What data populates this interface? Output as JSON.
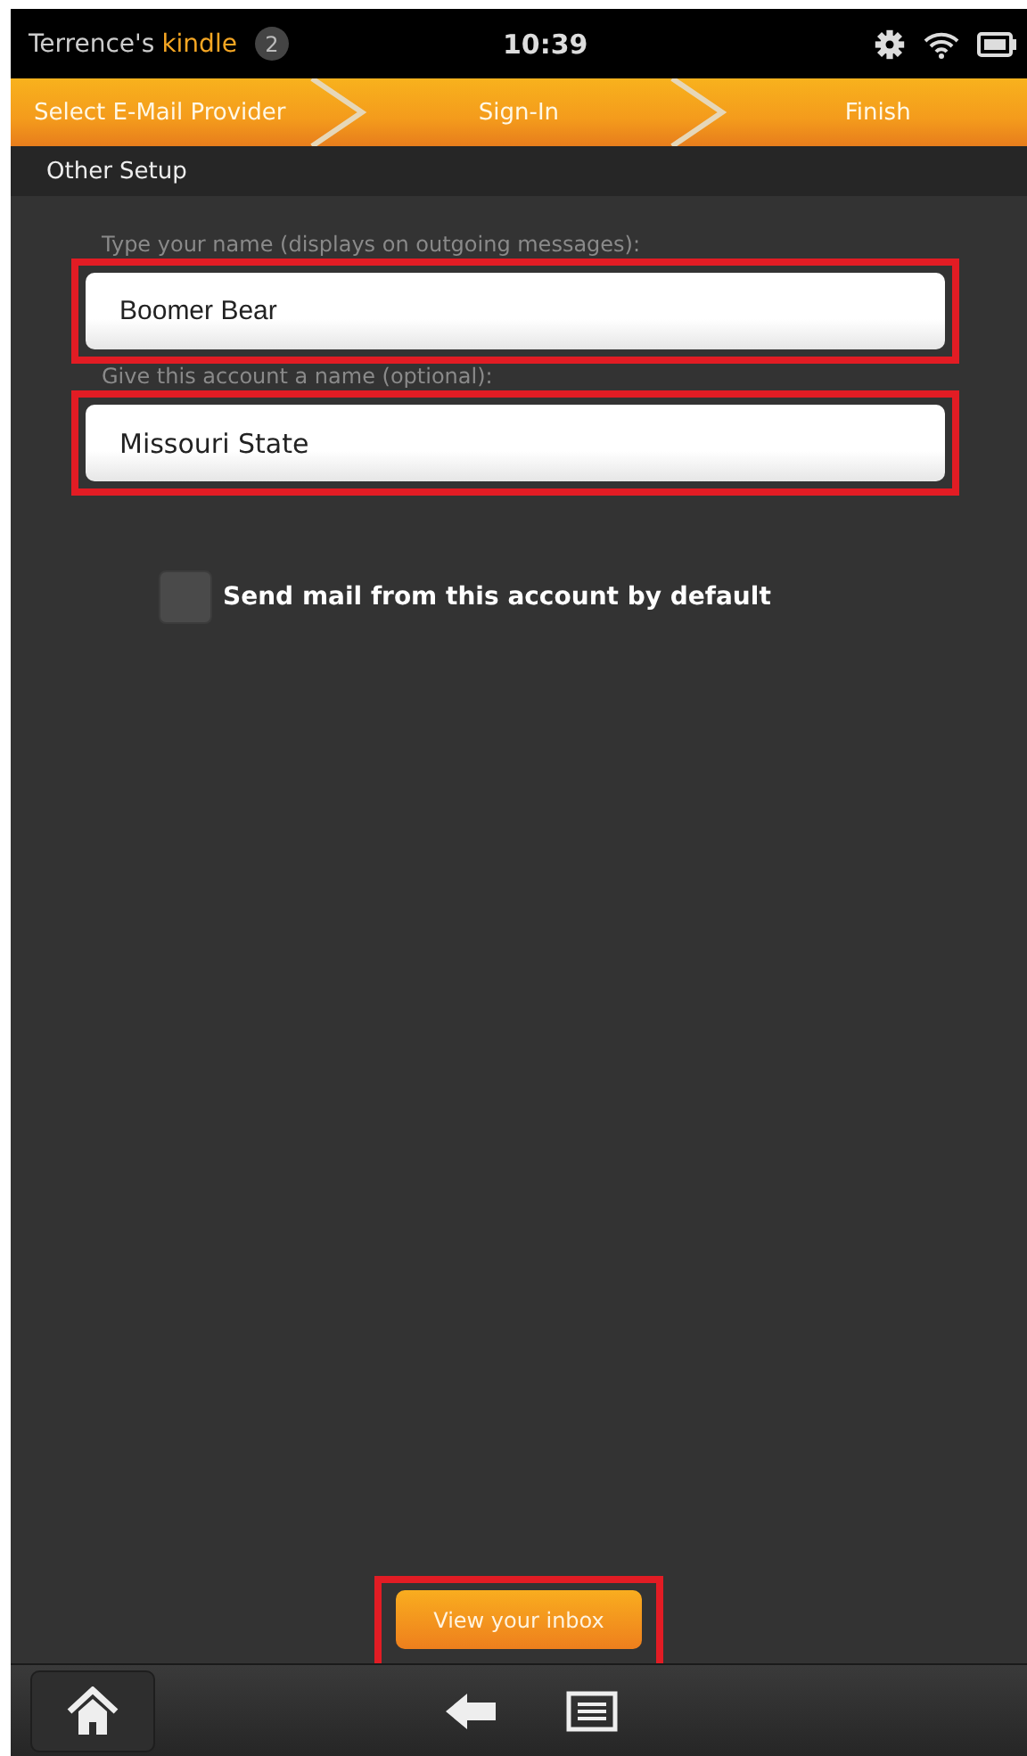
{
  "status_bar": {
    "device_owner": "Terrence's",
    "device_brand": "kindle",
    "notification_count": "2",
    "time": "10:39"
  },
  "steps": [
    {
      "label": "Select E-Mail Provider"
    },
    {
      "label": "Sign-In"
    },
    {
      "label": "Finish"
    }
  ],
  "section_title": "Other Setup",
  "fields": [
    {
      "label": "Type your name (displays on outgoing messages):",
      "value": "Boomer Bear",
      "highlighted": true
    },
    {
      "label": "Give this account a name (optional):",
      "value": "Missouri State",
      "highlighted": true
    }
  ],
  "default_checkbox": {
    "label": "Send mail from this account by default",
    "checked": false
  },
  "primary_button": {
    "label": "View your inbox",
    "highlighted": true
  }
}
